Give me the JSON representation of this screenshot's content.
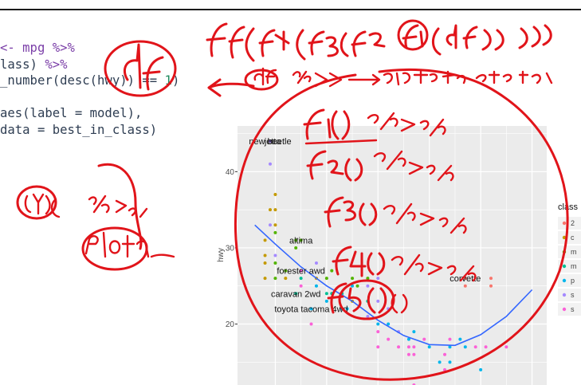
{
  "code_lines": [
    {
      "segments": [
        {
          "t": "<- mpg ",
          "c": "op"
        },
        {
          "t": "%>%",
          "c": "op"
        }
      ]
    },
    {
      "segments": [
        {
          "t": "lass) ",
          "c": "kw"
        },
        {
          "t": "%>%",
          "c": "op"
        }
      ]
    },
    {
      "segments": [
        {
          "t": "_number(desc(hwy)) == ",
          "c": "kw"
        },
        {
          "t": "1",
          "c": "num"
        },
        {
          "t": ")",
          "c": "kw"
        }
      ]
    },
    {
      "segments": [
        {
          "t": "",
          "c": "kw"
        }
      ]
    },
    {
      "segments": [
        {
          "t": "aes(label = model),",
          "c": "kw"
        }
      ]
    },
    {
      "segments": [
        {
          "t": "data = best_in_class)",
          "c": "kw"
        }
      ]
    }
  ],
  "handwriting": {
    "nested_call": "f5(f4(f3(f2(f1(df)))))",
    "df_arrow_note": "df %>% → 데이터보내기, 연결하기",
    "steps": [
      "f1( ) %>%",
      "f2( ) %>%",
      "f3( ) %>%",
      "f4( ) %>%",
      "f5( )"
    ],
    "circled_df": "df",
    "left_notes": [
      "(Y)(",
      "%>%",
      "plot)"
    ]
  },
  "chart_data": {
    "type": "scatter",
    "xlabel": "",
    "ylabel": "hwy",
    "y_ticks": [
      20,
      30,
      40
    ],
    "ylim": [
      12,
      46
    ],
    "legend_title": "class",
    "legend_entries": [
      {
        "label": "2",
        "color": "#F8766D"
      },
      {
        "label": "c",
        "color": "#C49A00"
      },
      {
        "label": "m",
        "color": "#53B400"
      },
      {
        "label": "m",
        "color": "#00C094"
      },
      {
        "label": "p",
        "color": "#00B6EB"
      },
      {
        "label": "s",
        "color": "#A58AFF"
      },
      {
        "label": "s",
        "color": "#FB61D7"
      }
    ],
    "labels": [
      {
        "text": "new beetle",
        "x": 1.9,
        "y": 44
      },
      {
        "text": "jetta",
        "x": 1.95,
        "y": 44
      },
      {
        "text": "altima",
        "x": 2.5,
        "y": 31
      },
      {
        "text": "forester awd",
        "x": 2.5,
        "y": 27
      },
      {
        "text": "caravan 2wd",
        "x": 2.4,
        "y": 24
      },
      {
        "text": "toyota tacoma 4wd",
        "x": 2.7,
        "y": 22
      },
      {
        "text": "corvette",
        "x": 5.7,
        "y": 26
      }
    ],
    "smooth_color": "#3366FF",
    "points": [
      {
        "x": 1.8,
        "y": 29,
        "c": 1
      },
      {
        "x": 1.8,
        "y": 31,
        "c": 1
      },
      {
        "x": 1.8,
        "y": 26,
        "c": 1
      },
      {
        "x": 1.8,
        "y": 28,
        "c": 1
      },
      {
        "x": 1.9,
        "y": 33,
        "c": 5
      },
      {
        "x": 1.9,
        "y": 35,
        "c": 1
      },
      {
        "x": 1.9,
        "y": 41,
        "c": 5
      },
      {
        "x": 1.9,
        "y": 44,
        "c": 5
      },
      {
        "x": 2.0,
        "y": 26,
        "c": 2
      },
      {
        "x": 2.0,
        "y": 29,
        "c": 5
      },
      {
        "x": 2.0,
        "y": 28,
        "c": 2
      },
      {
        "x": 2.0,
        "y": 32,
        "c": 2
      },
      {
        "x": 2.2,
        "y": 27,
        "c": 2
      },
      {
        "x": 2.2,
        "y": 26,
        "c": 1
      },
      {
        "x": 2.4,
        "y": 31,
        "c": 2
      },
      {
        "x": 2.4,
        "y": 30,
        "c": 2
      },
      {
        "x": 2.4,
        "y": 24,
        "c": 3
      },
      {
        "x": 2.5,
        "y": 27,
        "c": 6
      },
      {
        "x": 2.5,
        "y": 31,
        "c": 2
      },
      {
        "x": 2.5,
        "y": 26,
        "c": 3
      },
      {
        "x": 2.5,
        "y": 25,
        "c": 6
      },
      {
        "x": 2.7,
        "y": 22,
        "c": 4
      },
      {
        "x": 2.7,
        "y": 20,
        "c": 6
      },
      {
        "x": 2.8,
        "y": 26,
        "c": 1
      },
      {
        "x": 2.8,
        "y": 25,
        "c": 4
      },
      {
        "x": 3.0,
        "y": 26,
        "c": 2
      },
      {
        "x": 3.0,
        "y": 24,
        "c": 3
      },
      {
        "x": 3.0,
        "y": 23,
        "c": 4
      },
      {
        "x": 3.1,
        "y": 27,
        "c": 2
      },
      {
        "x": 3.3,
        "y": 24,
        "c": 3
      },
      {
        "x": 3.3,
        "y": 22,
        "c": 4
      },
      {
        "x": 3.5,
        "y": 26,
        "c": 2
      },
      {
        "x": 3.5,
        "y": 25,
        "c": 4
      },
      {
        "x": 3.5,
        "y": 23,
        "c": 1
      },
      {
        "x": 3.6,
        "y": 25,
        "c": 2
      },
      {
        "x": 3.8,
        "y": 23,
        "c": 3
      },
      {
        "x": 3.8,
        "y": 21,
        "c": 5
      },
      {
        "x": 3.8,
        "y": 26,
        "c": 2
      },
      {
        "x": 4.0,
        "y": 20,
        "c": 4
      },
      {
        "x": 4.0,
        "y": 19,
        "c": 6
      },
      {
        "x": 4.0,
        "y": 17,
        "c": 6
      },
      {
        "x": 4.2,
        "y": 18,
        "c": 6
      },
      {
        "x": 4.2,
        "y": 22,
        "c": 5
      },
      {
        "x": 4.4,
        "y": 17,
        "c": 6
      },
      {
        "x": 4.6,
        "y": 17,
        "c": 6
      },
      {
        "x": 4.6,
        "y": 18,
        "c": 4
      },
      {
        "x": 4.7,
        "y": 17,
        "c": 6
      },
      {
        "x": 4.7,
        "y": 19,
        "c": 4
      },
      {
        "x": 4.7,
        "y": 12,
        "c": 6
      },
      {
        "x": 5.0,
        "y": 17,
        "c": 4
      },
      {
        "x": 5.2,
        "y": 15,
        "c": 4
      },
      {
        "x": 5.3,
        "y": 16,
        "c": 6
      },
      {
        "x": 5.3,
        "y": 14,
        "c": 6
      },
      {
        "x": 5.4,
        "y": 17,
        "c": 4
      },
      {
        "x": 5.4,
        "y": 18,
        "c": 6
      },
      {
        "x": 5.6,
        "y": 18,
        "c": 4
      },
      {
        "x": 5.7,
        "y": 17,
        "c": 4
      },
      {
        "x": 5.7,
        "y": 26,
        "c": 0
      },
      {
        "x": 5.7,
        "y": 25,
        "c": 0
      },
      {
        "x": 5.9,
        "y": 17,
        "c": 6
      },
      {
        "x": 6.0,
        "y": 14,
        "c": 4
      },
      {
        "x": 6.1,
        "y": 17,
        "c": 6
      },
      {
        "x": 6.2,
        "y": 26,
        "c": 0
      },
      {
        "x": 6.2,
        "y": 25,
        "c": 0
      },
      {
        "x": 6.5,
        "y": 17,
        "c": 6
      },
      {
        "x": 4.0,
        "y": 26,
        "c": 5
      },
      {
        "x": 4.0,
        "y": 23,
        "c": 5
      },
      {
        "x": 3.8,
        "y": 25,
        "c": 5
      },
      {
        "x": 2.8,
        "y": 28,
        "c": 5
      },
      {
        "x": 4.6,
        "y": 16,
        "c": 6
      },
      {
        "x": 4.9,
        "y": 18,
        "c": 6
      },
      {
        "x": 3.1,
        "y": 24,
        "c": 3
      },
      {
        "x": 2.0,
        "y": 37,
        "c": 1
      },
      {
        "x": 2.0,
        "y": 35,
        "c": 1
      },
      {
        "x": 2.0,
        "y": 33,
        "c": 1
      },
      {
        "x": 3.4,
        "y": 22,
        "c": 4
      },
      {
        "x": 4.2,
        "y": 20,
        "c": 4
      },
      {
        "x": 4.4,
        "y": 19,
        "c": 5
      },
      {
        "x": 4.7,
        "y": 16,
        "c": 6
      },
      {
        "x": 5.4,
        "y": 15,
        "c": 4
      }
    ],
    "smooth": [
      {
        "x": 1.6,
        "y": 33
      },
      {
        "x": 2.0,
        "y": 30.5
      },
      {
        "x": 2.5,
        "y": 27.5
      },
      {
        "x": 3.0,
        "y": 25
      },
      {
        "x": 3.5,
        "y": 23
      },
      {
        "x": 4.0,
        "y": 20.5
      },
      {
        "x": 4.5,
        "y": 18.5
      },
      {
        "x": 5.0,
        "y": 17.3
      },
      {
        "x": 5.5,
        "y": 17.2
      },
      {
        "x": 6.0,
        "y": 18.6
      },
      {
        "x": 6.5,
        "y": 21
      },
      {
        "x": 7.0,
        "y": 24.5
      }
    ]
  }
}
